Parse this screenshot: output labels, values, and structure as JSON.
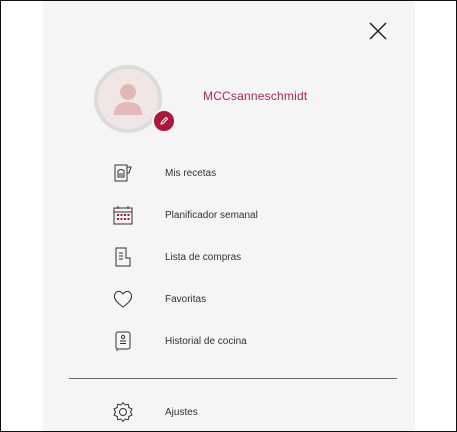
{
  "profile": {
    "username": "MCCsanneschmidt"
  },
  "menu": {
    "items": [
      {
        "label": "Mis recetas",
        "icon": "recipe-jar-icon"
      },
      {
        "label": "Planificador semanal",
        "icon": "calendar-icon"
      },
      {
        "label": "Lista de compras",
        "icon": "shopping-list-icon"
      },
      {
        "label": "Favoritas",
        "icon": "heart-icon"
      },
      {
        "label": "Historial de cocina",
        "icon": "cooking-history-icon"
      }
    ],
    "settings": {
      "label": "Ajustes",
      "icon": "gear-icon"
    }
  },
  "colors": {
    "accent": "#b2294c",
    "badge": "#a8193b",
    "panel_bg": "#f5f5f5"
  }
}
